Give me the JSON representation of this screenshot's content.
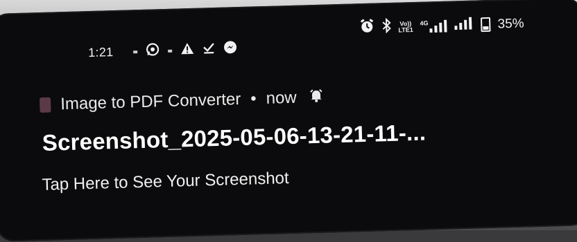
{
  "status_bar": {
    "time": "1:21",
    "left_icons": [
      "notification-dot-icon",
      "whatsapp-icon",
      "notification-dot-icon",
      "warning-icon",
      "download-done-icon",
      "messenger-icon"
    ],
    "right_icons": [
      "alarm-icon",
      "bluetooth-icon",
      "volte-icon",
      "4g-signal-icon",
      "signal-bars-icon",
      "battery-icon"
    ],
    "volte_label_top": "Vo))",
    "volte_label_bottom": "LTE1",
    "network_label": "4G",
    "battery_percent": "35%"
  },
  "notification": {
    "app_name": "Image to PDF Converter",
    "separator": "•",
    "time": "now",
    "title": "Screenshot_2025-05-06-13-21-11-...",
    "body": "Tap Here to See Your Screenshot"
  }
}
